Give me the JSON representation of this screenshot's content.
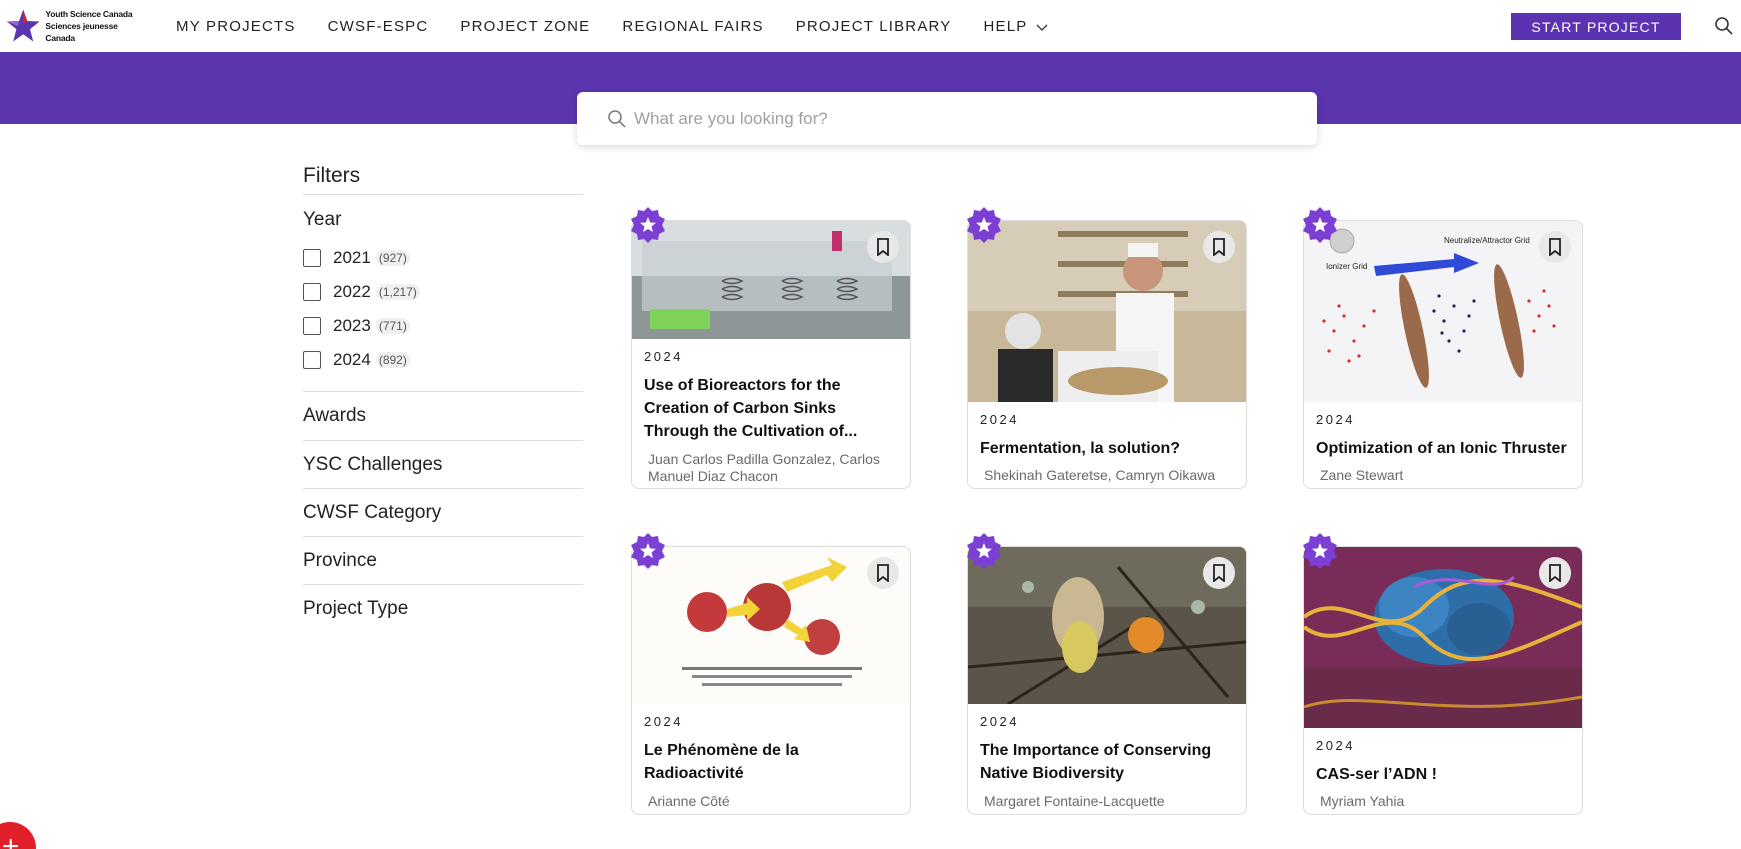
{
  "logo": {
    "line1": "Youth Science Canada",
    "line2": "Sciences jeunesse Canada"
  },
  "nav": [
    {
      "label": "MY PROJECTS"
    },
    {
      "label": "CWSF-ESPC"
    },
    {
      "label": "PROJECT ZONE"
    },
    {
      "label": "REGIONAL FAIRS"
    },
    {
      "label": "PROJECT LIBRARY"
    },
    {
      "label": "HELP"
    }
  ],
  "start_project": "START PROJECT",
  "search": {
    "placeholder": "What are you looking for?"
  },
  "filters": {
    "title": "Filters",
    "year_title": "Year",
    "years": [
      {
        "year": "2021",
        "count": "(927)"
      },
      {
        "year": "2022",
        "count": "(1,217)"
      },
      {
        "year": "2023",
        "count": "(771)"
      },
      {
        "year": "2024",
        "count": "(892)"
      }
    ],
    "sections": [
      "Awards",
      "YSC Challenges",
      "CWSF Category",
      "Province",
      "Project Type"
    ]
  },
  "cards": [
    {
      "year": "2024",
      "title": "Use of Bioreactors for the Creation of Carbon Sinks Through the Cultivation of...",
      "authors": "Juan Carlos Padilla Gonzalez, Carlos Manuel Diaz Chacon"
    },
    {
      "year": "2024",
      "title": "Fermentation, la solution?",
      "authors": "Shekinah Gateretse, Camryn Oikawa"
    },
    {
      "year": "2024",
      "title": "Optimization of an Ionic Thruster",
      "authors": "Zane Stewart",
      "img_labels": {
        "ionizer": "Ionizer Grid",
        "neutralize": "Neutralize/Attractor Grid"
      }
    },
    {
      "year": "2024",
      "title": "Le Phénomène de la Radioactivité",
      "authors": "Arianne Côté"
    },
    {
      "year": "2024",
      "title": "The Importance of Conserving Native Biodiversity",
      "authors": "Margaret Fontaine-Lacquette"
    },
    {
      "year": "2024",
      "title": "CAS-ser l’ADN !",
      "authors": "Myriam Yahia"
    }
  ],
  "colors": {
    "brand_purple": "#5b35ad",
    "badge_purple": "#7b3fd4"
  }
}
